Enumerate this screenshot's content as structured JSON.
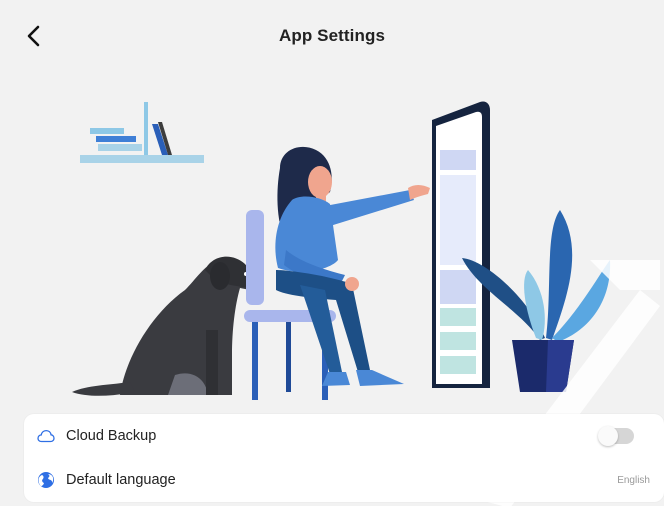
{
  "header": {
    "title": "App Settings",
    "back_icon": "chevron-left-icon"
  },
  "settings": {
    "cloud_backup": {
      "label": "Cloud Backup",
      "icon": "cloud-icon",
      "enabled": false
    },
    "default_language": {
      "label": "Default language",
      "icon": "globe-icon",
      "value": "English"
    }
  },
  "colors": {
    "background": "#f2f2f2",
    "card": "#ffffff",
    "accent_blue": "#2f6fe4",
    "toggle_off": "#d6d6d6"
  }
}
